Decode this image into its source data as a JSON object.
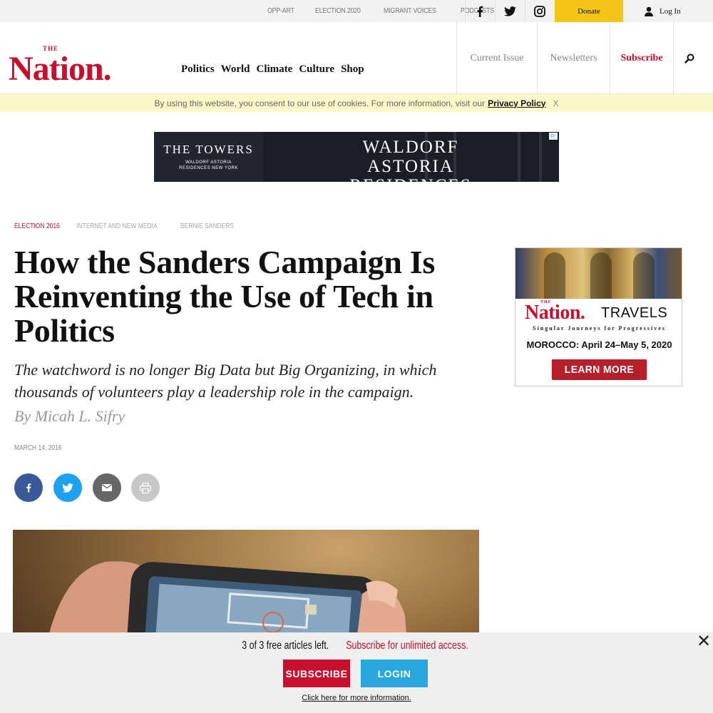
{
  "topbar": {
    "links": [
      "OPP-ART",
      "ELECTION 2020",
      "MIGRANT VOICES",
      "PODCASTS"
    ],
    "social": [
      "facebook-icon",
      "twitter-icon",
      "instagram-icon"
    ],
    "donate": "Donate",
    "login": "Log In"
  },
  "header": {
    "logo": "Nation.",
    "logo_small": "THE",
    "nav": [
      "Politics",
      "World",
      "Climate",
      "Culture",
      "Shop"
    ],
    "current_issue": "Current Issue",
    "newsletters": "Newsletters",
    "subscribe": "Subscribe",
    "search_icon": "search-icon"
  },
  "cookie": {
    "text": "By using this website, you consent to our use of cookies. For more information, visit our",
    "link": "Privacy Policy",
    "close": "X"
  },
  "top_ad": {
    "left_title": "THE TOWERS",
    "left_sub": "WALDORF ASTORIA RESIDENCES NEW YORK",
    "right_title": "WALDORF ASTORIA RESIDENCES"
  },
  "article": {
    "tags": [
      "ELECTION 2016",
      "INTERNET AND NEW MEDIA",
      "BERNIE SANDERS"
    ],
    "headline": "How the Sanders Campaign Is Reinventing the Use of Tech in Politics",
    "dek": "The watchword is no longer Big Data but Big Organizing, in which thousands of volunteers play a leadership role in the campaign.",
    "byline": "By Micah L. Sifry",
    "date": "MARCH 14, 2016"
  },
  "share": {
    "colors": {
      "facebook": "#3b5998",
      "twitter": "#1da1f2",
      "email": "#666666",
      "print": "#c8c8c8"
    }
  },
  "side_ad": {
    "brand": "Nation.",
    "brand_small": "THE",
    "travels": "TRAVELS",
    "tagline": "Singular Journeys for Progressives",
    "trip": "MOROCCO: April 24–May 5, 2020",
    "cta": "LEARN MORE"
  },
  "paywall": {
    "count": "3 of 3 free articles left.",
    "cta_text": "Subscribe for unlimited access.",
    "subscribe": "SUBSCRIBE",
    "login": "LOGIN",
    "info": "Click here for more information."
  },
  "colors": {
    "brand_red": "#c8102e",
    "donate_yellow": "#f5c518",
    "cookie_bg": "#fcf8c8",
    "login_blue": "#29a8e0"
  }
}
